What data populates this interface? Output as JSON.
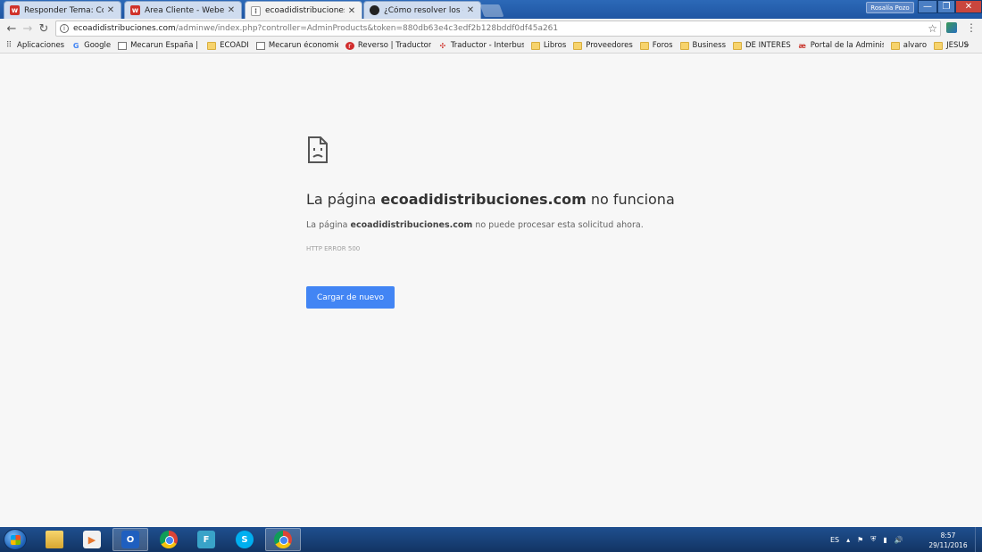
{
  "tabs": [
    {
      "label": "Responder Tema: Configu",
      "icon": "webempresa-icon"
    },
    {
      "label": "Área Cliente - Webempr",
      "icon": "webempresa-icon"
    },
    {
      "label": "ecoadidistribuciones.com",
      "icon": "sad-page-icon"
    },
    {
      "label": "¿Cómo resolver los errores",
      "icon": "circle-icon"
    }
  ],
  "window": {
    "user": "Rosalía Pozo"
  },
  "address_bar": {
    "host": "ecoadidistribuciones.com",
    "path": "/adminwe/index.php?controller=AdminProducts&token=880db63e4c3edf2b128bddf0df45a261"
  },
  "bookmarks": [
    {
      "label": "Aplicaciones",
      "icon": "apps-icon"
    },
    {
      "label": "Google",
      "icon": "google-icon"
    },
    {
      "label": "Mecarun España | Siti",
      "icon": "page-icon"
    },
    {
      "label": "ECOADI",
      "icon": "folder-icon"
    },
    {
      "label": "Mecarun économie de",
      "icon": "page-icon"
    },
    {
      "label": "Reverso | Traductor, d",
      "icon": "reverso-icon"
    },
    {
      "label": "Traductor - Interbusca",
      "icon": "puzzle-icon"
    },
    {
      "label": "Libros",
      "icon": "folder-icon"
    },
    {
      "label": "Proveedores",
      "icon": "folder-icon"
    },
    {
      "label": "Foros",
      "icon": "folder-icon"
    },
    {
      "label": "Business",
      "icon": "folder-icon"
    },
    {
      "label": "DE INTERES",
      "icon": "folder-icon"
    },
    {
      "label": "Portal de la Administr",
      "icon": "ae-icon"
    },
    {
      "label": "alvaro",
      "icon": "folder-icon"
    },
    {
      "label": "JESUS",
      "icon": "folder-icon"
    }
  ],
  "error_page": {
    "title_prefix": "La página ",
    "title_host": "ecoadidistribuciones.com",
    "title_suffix": " no funciona",
    "desc_prefix": "La página ",
    "desc_host": "ecoadidistribuciones.com",
    "desc_suffix": " no puede procesar esta solicitud ahora.",
    "code": "HTTP ERROR 500",
    "reload_label": "Cargar de nuevo",
    "button_color": "#4285f4"
  },
  "taskbar": {
    "language": "ES",
    "time": "8:57",
    "date": "29/11/2016",
    "apps": [
      "explorer-icon",
      "media-player-icon",
      "outlook-icon",
      "chrome-icon",
      "f-app-icon",
      "skype-icon",
      "chrome-icon"
    ]
  }
}
